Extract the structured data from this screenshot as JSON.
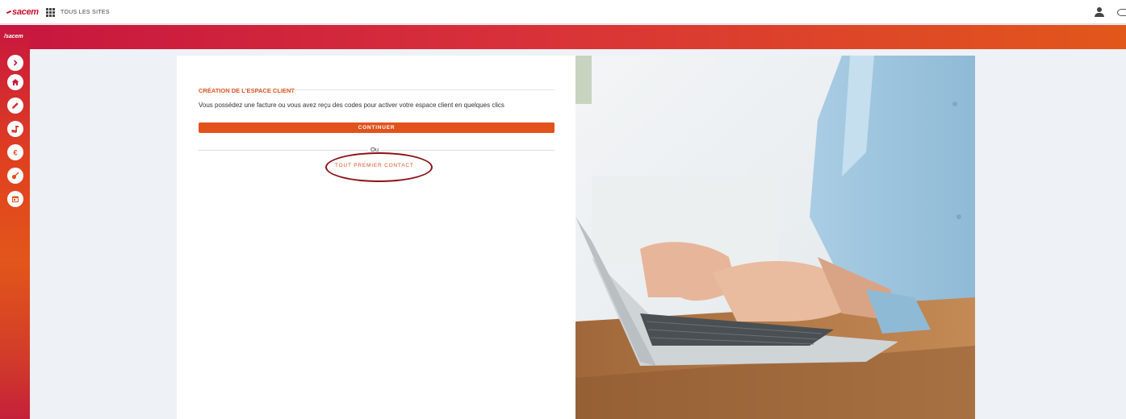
{
  "topbar": {
    "logo_text": "sacem",
    "apps_label": "TOUS LES SITES"
  },
  "sidebar": {
    "logo_text": "sacem",
    "items": [
      {
        "name": "expand",
        "icon": "chevron-right-icon"
      },
      {
        "name": "home",
        "icon": "home-icon"
      },
      {
        "name": "declare",
        "icon": "pencil-icon"
      },
      {
        "name": "works",
        "icon": "music-note-icon"
      },
      {
        "name": "payments",
        "icon": "euro-icon"
      },
      {
        "name": "tools",
        "icon": "guitar-icon"
      },
      {
        "name": "calendar",
        "icon": "calendar-icon"
      }
    ]
  },
  "main": {
    "section_title": "CRÉATION DE L'ESPACE CLIENT",
    "description": "Vous possédez une facture ou vous avez reçu des codes pour activer votre espace client en quelques clics",
    "continue_label": "CONTINUER",
    "separator_label": "Ou",
    "first_contact_label": "TOUT PREMIER CONTACT"
  },
  "colors": {
    "accent": "#e2531c",
    "gradient_start": "#c7163f",
    "gradient_end": "#e2571a",
    "annotation": "#8c1117"
  }
}
